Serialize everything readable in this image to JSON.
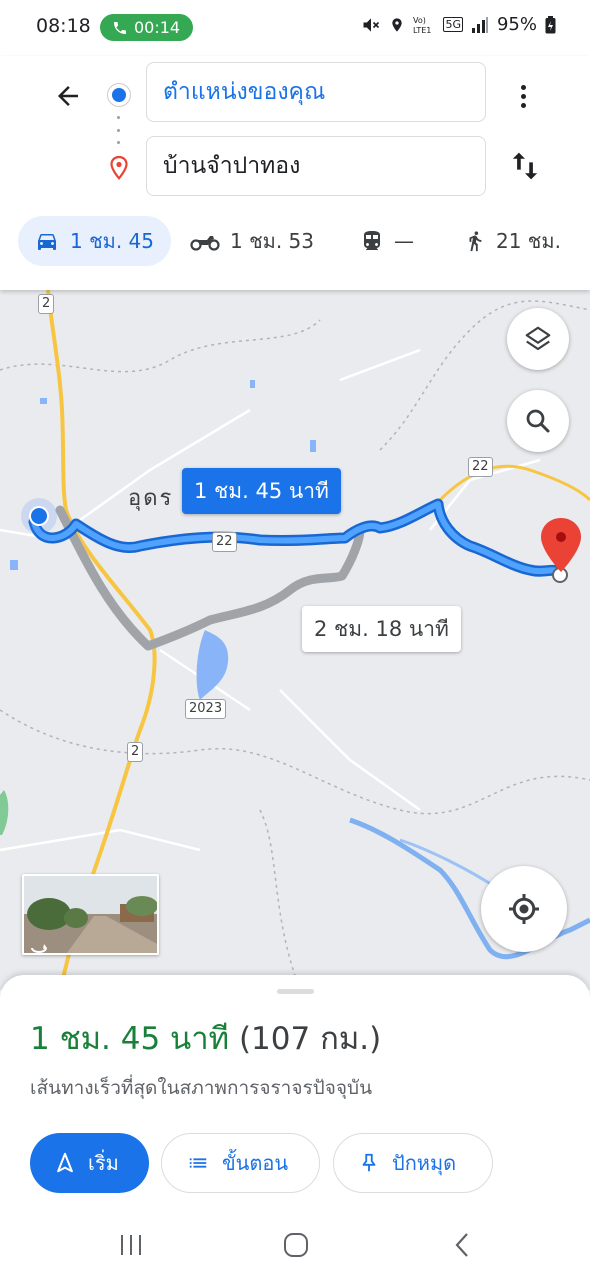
{
  "status_bar": {
    "time": "08:18",
    "call_duration": "00:14",
    "network": "5G",
    "battery": "95%"
  },
  "directions": {
    "origin": "ตำแหน่งของคุณ",
    "destination": "บ้านจำปาทอง"
  },
  "travel_modes": [
    {
      "mode": "car",
      "icon": "car-icon",
      "label": "1 ชม. 45"
    },
    {
      "mode": "motorcycle",
      "icon": "motorcycle-icon",
      "label": "1 ชม. 53"
    },
    {
      "mode": "transit",
      "icon": "train-icon",
      "label": "—"
    },
    {
      "mode": "walk",
      "icon": "walk-icon",
      "label": "21 ชม."
    }
  ],
  "map": {
    "primary_route_time": "1 ชม. 45 นาที",
    "alternate_route_time": "2 ชม. 18 นาที",
    "town_label": "อุดร",
    "road_shields": [
      "2",
      "22",
      "22",
      "2023",
      "2"
    ]
  },
  "sheet": {
    "duration": "1 ชม. 45 นาที",
    "distance": "(107 กม.)",
    "route_description": "เส้นทางเร็วที่สุดในสภาพการจราจรปัจจุบัน",
    "start_label": "เริ่ม",
    "steps_label": "ขั้นตอน",
    "pin_label": "ปักหมุด"
  },
  "colors": {
    "accent": "#1a73e8",
    "duration_green": "#188038",
    "route_blue": "#4285f4",
    "alt_route_gray": "#a0a4a8",
    "destination_red": "#ea4335"
  }
}
